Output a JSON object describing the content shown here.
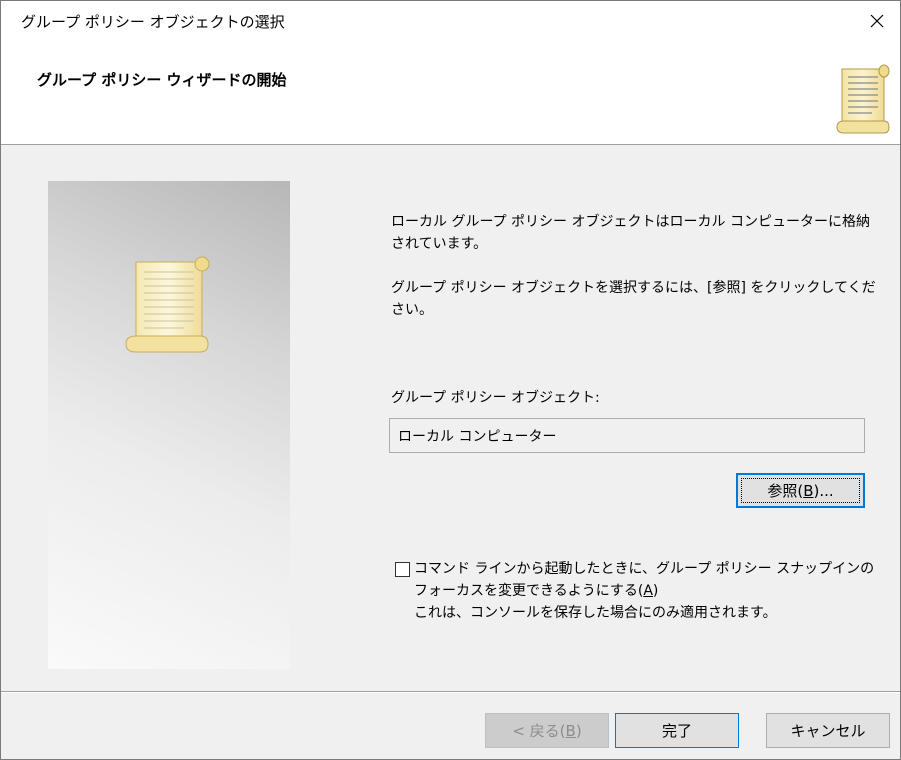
{
  "window": {
    "title": "グループ ポリシー オブジェクトの選択",
    "close_glyph": "✕"
  },
  "header": {
    "title": "グループ ポリシー ウィザードの開始",
    "icon": "scroll-document-icon"
  },
  "side_image": {
    "icon": "scroll-document-icon"
  },
  "body": {
    "description1": "ローカル グループ ポリシー オブジェクトはローカル コンピューターに格納されています。",
    "description2": "グループ ポリシー オブジェクトを選択するには、[参照] をクリックしてください。",
    "gpo_label": "グループ ポリシー オブジェクト:",
    "gpo_value": "ローカル コンピューター",
    "browse": {
      "label_prefix": "参照(",
      "accelerator": "B",
      "label_suffix": ")..."
    },
    "checkbox": {
      "checked": false,
      "label_part1": "コマンド ラインから起動したときに、グループ ポリシー スナップインのフォーカスを変更できるようにする(",
      "accelerator": "A",
      "label_part2": ")",
      "note": "これは、コンソールを保存した場合にのみ適用されます。"
    }
  },
  "footer": {
    "back": {
      "label_prefix": "< 戻る(",
      "accelerator": "B",
      "label_suffix": ")",
      "enabled": false
    },
    "finish_label": "完了",
    "cancel_label": "キャンセル"
  },
  "colors": {
    "accent": "#0078d7",
    "button_face": "#e1e1e1",
    "dialog_bg": "#f0f0f0",
    "header_bg": "#ffffff",
    "scroll_paper": "#f8eebd"
  }
}
